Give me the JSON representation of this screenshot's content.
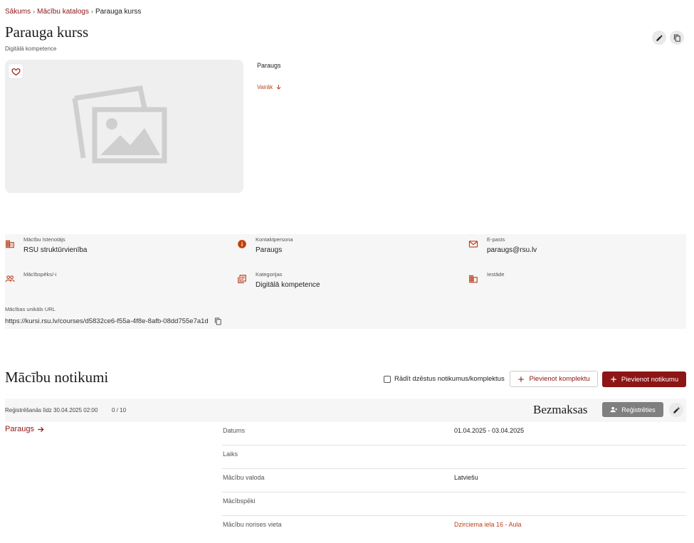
{
  "breadcrumb": {
    "items": [
      "Sākums",
      "Mācību katalogs"
    ],
    "current": "Parauga kurss",
    "separator": "›"
  },
  "course": {
    "title": "Parauga kurss",
    "subtitle": "Digitālā kompetence",
    "description": "Paraugs",
    "more_label": "Vairāk"
  },
  "info": {
    "provider_label": "Mācību īstenotājs",
    "provider_value": "RSU struktūrvienība",
    "contact_label": "Kontaktpersona",
    "contact_value": "Paraugs",
    "email_label": "E-pasts",
    "email_value": "paraugs@rsu.lv",
    "teachers_label": "Mācībspēks/-i",
    "categories_label": "Kategorijas",
    "categories_value": "Digitālā kompetence",
    "institution_label": "Iestāde",
    "url_label": "Mācības unikāls URL",
    "url_value": "https://kursi.rsu.lv/courses/d5832ce6-f55a-4f8e-8afb-08dd755e7a1d"
  },
  "events": {
    "title": "Mācību notikumi",
    "show_deleted_label": "Rādīt dzēstus notikumus/komplektus",
    "add_set_label": "Pievienot komplektu",
    "add_event_label": "Pievienot notikumu",
    "registration_deadline": "Reģistrēšanās līdz 30.04.2025 02:00",
    "seats": "0 / 10",
    "price": "Bezmaksas",
    "register_label": "Reģistrēties",
    "event_name": "Paraugs",
    "details": [
      {
        "key": "Datums",
        "value": "01.04.2025 - 03.04.2025"
      },
      {
        "key": "Laiks",
        "value": ""
      },
      {
        "key": "Mācību valoda",
        "value": "Latviešu"
      },
      {
        "key": "Mācībspēki",
        "value": ""
      },
      {
        "key": "Mācību norises vieta",
        "value": "Dzirciema iela 16 - Aula"
      }
    ]
  },
  "colors": {
    "accent": "#8c1515",
    "link": "#b8401c",
    "panel_bg": "#f6f6f6",
    "register_btn": "#7f7f7f"
  },
  "icons": [
    "edit-icon",
    "copy-icon",
    "heart-icon",
    "image-placeholder-icon",
    "arrow-down-icon",
    "building-icon",
    "info-icon",
    "mail-icon",
    "people-icon",
    "category-icon",
    "institution-icon",
    "plus-icon",
    "person-add-icon",
    "arrow-right-icon"
  ]
}
